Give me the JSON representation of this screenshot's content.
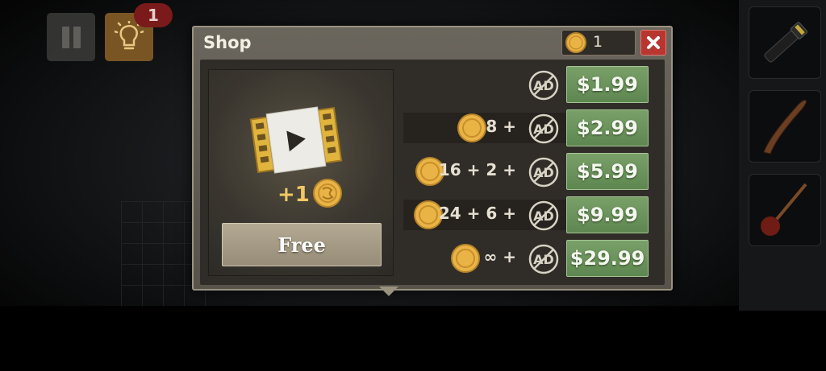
{
  "hud": {
    "hint_count": "1"
  },
  "shop": {
    "title": "Shop",
    "coin_balance": "1",
    "video_reward": "+1",
    "free_label": "Free",
    "offers": [
      {
        "quantity": "",
        "price": "$1.99"
      },
      {
        "quantity": "8 +",
        "price": "$2.99"
      },
      {
        "quantity": "16 + 2 +",
        "price": "$5.99"
      },
      {
        "quantity": "24 + 6 +",
        "price": "$9.99"
      },
      {
        "quantity": "∞ +",
        "price": "$29.99"
      }
    ]
  },
  "inventory": {
    "items": [
      "flashlight-icon",
      "wooden-stick-icon",
      "plunger-icon"
    ]
  },
  "colors": {
    "price_button": "#6b9459",
    "close_button": "#b83530",
    "coin": "#e9b445",
    "hint_badge": "#7a1a1a"
  }
}
